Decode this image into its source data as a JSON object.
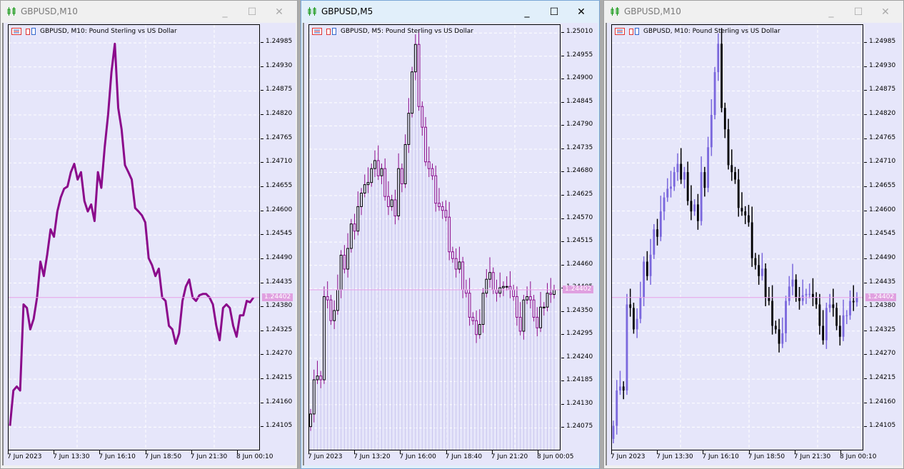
{
  "windows": [
    {
      "title": "GBPUSD,M10",
      "legend": "GBPUSD, M10:  Pound Sterling vs US Dollar",
      "active": false
    },
    {
      "title": "GBPUSD,M5",
      "legend": "GBPUSD, M5:  Pound Sterling vs US Dollar",
      "active": true
    },
    {
      "title": "GBPUSD,M10",
      "legend": "GBPUSD, M10:  Pound Sterling vs US Dollar",
      "active": false
    }
  ],
  "controls": {
    "minimize": "_",
    "maximize": "☐",
    "close": "✕"
  },
  "colors": {
    "line": "#8b0a8b",
    "bull": "#7b68dd",
    "bear": "#000000",
    "candle_outline": "#8b0a8b",
    "bid_line": "#e8a0e8",
    "grid": "#ffffff",
    "volume_fill": "#c8c4ee"
  },
  "chart_data": [
    {
      "type": "line",
      "symbol": "GBPUSD",
      "timeframe": "M10",
      "ylim": [
        1.2405,
        1.25026
      ],
      "yticks": [
        "1.24985",
        "1.24930",
        "1.24875",
        "1.24820",
        "1.24765",
        "1.24710",
        "1.24655",
        "1.24600",
        "1.24545",
        "1.24490",
        "1.24435",
        "1.24380",
        "1.24325",
        "1.24270",
        "1.24215",
        "1.24160",
        "1.24105"
      ],
      "xticks": [
        "7 Jun 2023",
        "7 Jun 13:30",
        "7 Jun 16:10",
        "7 Jun 18:50",
        "7 Jun 21:30",
        "8 Jun 00:10"
      ],
      "bid": "1.24402",
      "close": [
        1.24108,
        1.24189,
        1.24198,
        1.24189,
        1.24386,
        1.24378,
        1.24329,
        1.24353,
        1.24402,
        1.24484,
        1.24451,
        1.245,
        1.24558,
        1.24541,
        1.24599,
        1.24631,
        1.24651,
        1.24656,
        1.24689,
        1.24708,
        1.24672,
        1.24689,
        1.24623,
        1.24599,
        1.24615,
        1.24577,
        1.24689,
        1.24653,
        1.24746,
        1.2482,
        1.24918,
        1.24983,
        1.24836,
        1.24787,
        1.24705,
        1.24689,
        1.24672,
        1.24607,
        1.24599,
        1.2459,
        1.24574,
        1.24492,
        1.24476,
        1.24451,
        1.24468,
        1.24402,
        1.24394,
        1.24337,
        1.24329,
        1.24296,
        1.2432,
        1.24394,
        1.24427,
        1.24443,
        1.24402,
        1.24394,
        1.24407,
        1.2441,
        1.2441,
        1.24402,
        1.24386,
        1.24337,
        1.24304,
        1.24378,
        1.24386,
        1.24378,
        1.24337,
        1.24312,
        1.24361,
        1.24361,
        1.24394,
        1.24391,
        1.24402
      ]
    },
    {
      "type": "candlestick",
      "symbol": "GBPUSD",
      "timeframe": "M5",
      "ylim": [
        1.2402,
        1.25029
      ],
      "yticks": [
        "1.25010",
        "1.24955",
        "1.24900",
        "1.24845",
        "1.24790",
        "1.24735",
        "1.24680",
        "1.24625",
        "1.24570",
        "1.24515",
        "1.24460",
        "1.24405",
        "1.24350",
        "1.24295",
        "1.24240",
        "1.24185",
        "1.24130",
        "1.24075"
      ],
      "xticks": [
        "7 Jun 2023",
        "7 Jun 13:20",
        "7 Jun 16:00",
        "7 Jun 18:40",
        "7 Jun 21:20",
        "8 Jun 00:05"
      ],
      "bid": "1.24402",
      "close": [
        1.24108,
        1.24189,
        1.24198,
        1.24189,
        1.24386,
        1.24378,
        1.24329,
        1.24353,
        1.24402,
        1.24484,
        1.24451,
        1.245,
        1.24558,
        1.24541,
        1.24599,
        1.24631,
        1.24651,
        1.24656,
        1.24689,
        1.24708,
        1.24672,
        1.24689,
        1.24623,
        1.24599,
        1.24615,
        1.24577,
        1.24689,
        1.24653,
        1.24746,
        1.2482,
        1.24918,
        1.24983,
        1.24836,
        1.24787,
        1.24705,
        1.24689,
        1.24672,
        1.24607,
        1.24599,
        1.2459,
        1.24574,
        1.24492,
        1.24476,
        1.24451,
        1.24468,
        1.24402,
        1.24394,
        1.24337,
        1.24329,
        1.24296,
        1.2432,
        1.24394,
        1.24427,
        1.24443,
        1.24402,
        1.24394,
        1.24407,
        1.2441,
        1.2441,
        1.24402,
        1.24386,
        1.24337,
        1.24304,
        1.24378,
        1.24386,
        1.24378,
        1.24337,
        1.24312,
        1.24361,
        1.24361,
        1.24394,
        1.24391,
        1.24402
      ]
    },
    {
      "type": "candlestick",
      "symbol": "GBPUSD",
      "timeframe": "M10",
      "ylim": [
        1.2405,
        1.25026
      ],
      "yticks": [
        "1.24985",
        "1.24930",
        "1.24875",
        "1.24820",
        "1.24765",
        "1.24710",
        "1.24655",
        "1.24600",
        "1.24545",
        "1.24490",
        "1.24435",
        "1.24380",
        "1.24325",
        "1.24270",
        "1.24215",
        "1.24160",
        "1.24105"
      ],
      "xticks": [
        "7 Jun 2023",
        "7 Jun 13:30",
        "7 Jun 16:10",
        "7 Jun 18:50",
        "7 Jun 21:30",
        "8 Jun 00:10"
      ],
      "bid": "1.24402",
      "close": [
        1.24108,
        1.24189,
        1.24198,
        1.24189,
        1.24386,
        1.24378,
        1.24329,
        1.24353,
        1.24402,
        1.24484,
        1.24451,
        1.245,
        1.24558,
        1.24541,
        1.24599,
        1.24631,
        1.24651,
        1.24656,
        1.24689,
        1.24708,
        1.24672,
        1.24689,
        1.24623,
        1.24599,
        1.24615,
        1.24577,
        1.24689,
        1.24653,
        1.24746,
        1.2482,
        1.24918,
        1.24983,
        1.24836,
        1.24787,
        1.24705,
        1.24689,
        1.24672,
        1.24607,
        1.24599,
        1.2459,
        1.24574,
        1.24492,
        1.24476,
        1.24451,
        1.24468,
        1.24402,
        1.24394,
        1.24337,
        1.24329,
        1.24296,
        1.2432,
        1.24394,
        1.24427,
        1.24443,
        1.24402,
        1.24394,
        1.24407,
        1.2441,
        1.2441,
        1.24402,
        1.24386,
        1.24337,
        1.24304,
        1.24378,
        1.24386,
        1.24378,
        1.24337,
        1.24312,
        1.24361,
        1.24361,
        1.24394,
        1.24391,
        1.24402
      ]
    }
  ]
}
